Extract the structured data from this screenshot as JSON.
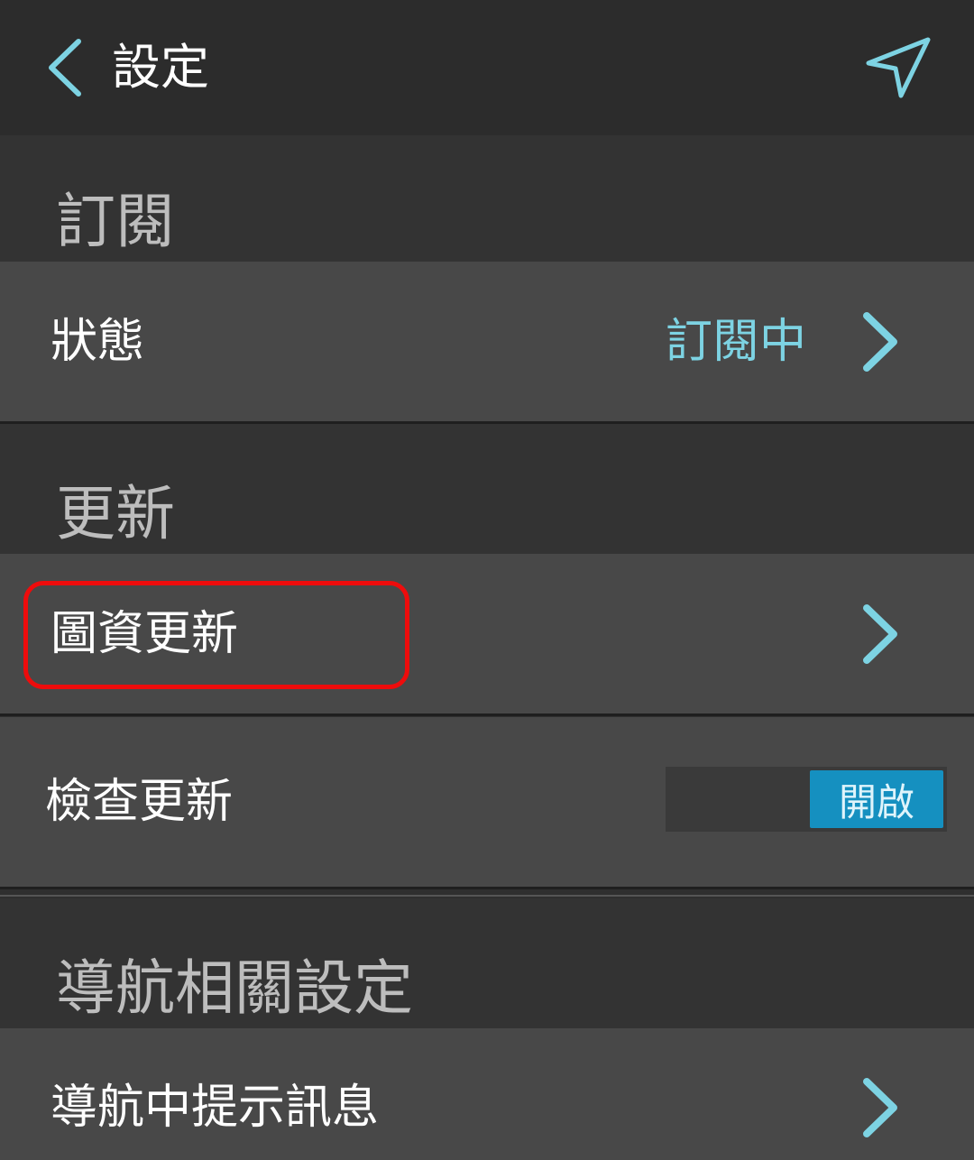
{
  "header": {
    "title": "設定",
    "back_icon": "chevron-left-icon",
    "action_icon": "navigation-arrow-icon",
    "accent_color": "#7dd3e3"
  },
  "sections": {
    "subscription": {
      "title": "訂閱",
      "status_row": {
        "label": "狀態",
        "value": "訂閱中"
      }
    },
    "update": {
      "title": "更新",
      "map_update_row": {
        "label": "圖資更新"
      },
      "check_update_row": {
        "label": "檢查更新",
        "toggle_label": "開啟",
        "toggle_on": true
      }
    },
    "navigation": {
      "title": "導航相關設定",
      "nav_message_row": {
        "label": "導航中提示訊息"
      }
    }
  },
  "colors": {
    "highlight": "#ee0c0c",
    "toggle_on": "#1590c0",
    "row_bg": "#484848",
    "section_bg": "#333333"
  }
}
